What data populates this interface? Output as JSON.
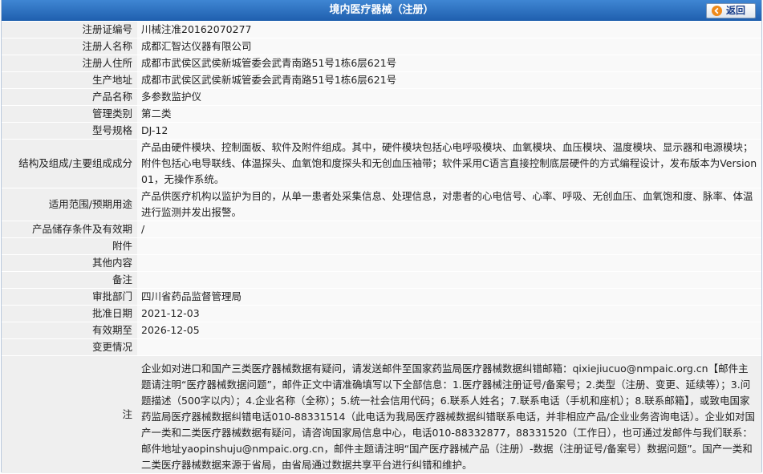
{
  "header": {
    "title": "境内医疗器械（注册）",
    "back_label": "返回"
  },
  "rows": [
    {
      "label": "注册证编号",
      "value": "川械注准20162070277"
    },
    {
      "label": "注册人名称",
      "value": "成都汇智达仪器有限公司"
    },
    {
      "label": "注册人住所",
      "value": "成都市武侯区武侯新城管委会武青南路51号1栋6层621号"
    },
    {
      "label": "生产地址",
      "value": "成都市武侯区武侯新城管委会武青南路51号1栋6层621号"
    },
    {
      "label": "产品名称",
      "value": "多参数监护仪"
    },
    {
      "label": "管理类别",
      "value": "第二类"
    },
    {
      "label": "型号规格",
      "value": "DJ-12"
    },
    {
      "label": "结构及组成/主要组成成分",
      "value": "产品由硬件模块、控制面板、软件及附件组成。其中，硬件模块包括心电呼吸模块、血氧模块、血压模块、温度模块、显示器和电源模块；附件包括心电导联线、体温探头、血氧饱和度探头和无创血压袖带；软件采用C语言直接控制底层硬件的方式编程设计，发布版本为Version 01，无操作系统。"
    },
    {
      "label": "适用范围/预期用途",
      "value": "产品供医疗机构以监护为目的，从单一患者处采集信息、处理信息，对患者的心电信号、心率、呼吸、无创血压、血氧饱和度、脉率、体温进行监测并发出报警。"
    },
    {
      "label": "产品储存条件及有效期",
      "value": "/"
    },
    {
      "label": "附件",
      "value": ""
    },
    {
      "label": "其他内容",
      "value": ""
    },
    {
      "label": "备注",
      "value": ""
    },
    {
      "label": "审批部门",
      "value": "四川省药品监督管理局"
    },
    {
      "label": "批准日期",
      "value": "2021-12-03"
    },
    {
      "label": "有效期至",
      "value": "2026-12-05"
    },
    {
      "label": "变更情况",
      "value": ""
    }
  ],
  "note": {
    "label": "注",
    "text": "企业如对进口和国产三类医疗器械数据有疑问，请发送邮件至国家药监局医疗器械数据纠错邮箱：qixiejiucuo@nmpaic.org.cn【邮件主题请注明“医疗器械数据问题”，邮件正文中请准确填写以下全部信息：1.医疗器械注册证号/备案号；2.类型（注册、变更、延续等）；3.问题描述（500字以内）；4.企业名称（全称）；5.统一社会信用代码；6.联系人姓名；7.联系电话（手机和座机）；8.联系邮箱】，或致电国家药监局医疗器械数据纠错电话010-88331514（此电话为我局医疗器械数据纠错联系电话，并非相应产品/企业业务咨询电话）。企业如对国产一类和二类医疗器械数据有疑问，请咨询国家局信息中心，电话010-88332877，88331520（工作日），也可通过发邮件与我们联系：邮件地址yaopinshuju@nmpaic.org.cn，邮件主题请注明“国产医疗器械产品（注册）-数据（注册证号/备案号）数据问题”。国产一类和二类医疗器械数据来源于省局，由省局通过数据共享平台进行纠错和维护。"
  },
  "colors": {
    "header_bg": "#1f5fae",
    "label_bg": "#efefef",
    "value_bg": "#f9f9f9"
  }
}
